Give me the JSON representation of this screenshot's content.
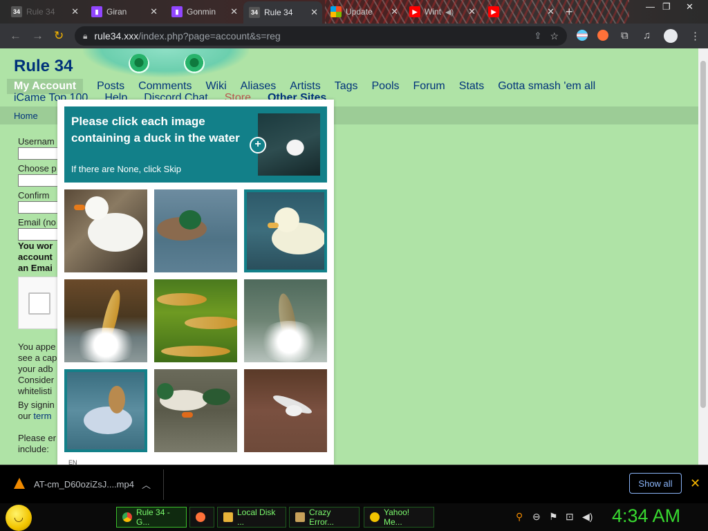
{
  "browser": {
    "tabs": [
      {
        "title": "Rule 34",
        "favicon": "34",
        "favicon_color": "#444444"
      },
      {
        "title": "Giran",
        "favicon": "T",
        "favicon_color": "#9146ff"
      },
      {
        "title": "Gonmin",
        "favicon": "T",
        "favicon_color": "#9146ff"
      },
      {
        "title": "Rule 34",
        "favicon": "34",
        "favicon_color": "#444444",
        "active": true
      },
      {
        "title": "Update",
        "favicon": "ms",
        "favicon_color": "#f25022"
      },
      {
        "title": "Wint",
        "favicon": "yt",
        "favicon_color": "#ff0000"
      },
      {
        "title": "",
        "favicon": "yt",
        "favicon_color": "#ff0000"
      }
    ],
    "new_tab": "+",
    "address": {
      "host": "rule34.xxx",
      "path": "/index.php?page=account&s=reg"
    }
  },
  "site": {
    "title": "Rule 34",
    "nav": [
      "My Account",
      "Posts",
      "Comments",
      "Wiki",
      "Aliases",
      "Artists",
      "Tags",
      "Pools",
      "Forum",
      "Stats",
      "Gotta smash 'em all"
    ],
    "nav2": [
      "iCame Top 100",
      "Help",
      "Discord Chat",
      "Store",
      "Other Sites"
    ],
    "subnav": {
      "home": "Home"
    }
  },
  "form": {
    "username": "Usernam",
    "password": "Choose p",
    "confirm": "Confirm",
    "email": "Email (no",
    "warning": [
      "You wor",
      "account",
      "an Emai"
    ],
    "adblock": [
      "You appe",
      "see a cap",
      "your adb",
      "Consider",
      "whitelisti"
    ],
    "signing": [
      "By signin"
    ],
    "terms_prefix": "our ",
    "terms_link": "term",
    "please": [
      "Please er",
      "include:"
    ]
  },
  "captcha": {
    "prompt": "Please click each image containing a duck in the water",
    "sub": "If there are None, click Skip",
    "language": "EN",
    "grid": [
      {
        "subject": "white-duck-on-rocks",
        "selected": false
      },
      {
        "subject": "mallard-in-water",
        "selected": false
      },
      {
        "subject": "white-duck-in-water",
        "selected": true
      },
      {
        "subject": "fish-jumping",
        "selected": false
      },
      {
        "subject": "fish-underwater",
        "selected": false
      },
      {
        "subject": "fish-splashing",
        "selected": false
      },
      {
        "subject": "pale-duck-in-water",
        "selected": true
      },
      {
        "subject": "mallards-swimming",
        "selected": false
      },
      {
        "subject": "bird-over-water",
        "selected": false
      }
    ],
    "accent": "#128089"
  },
  "downloads": {
    "file": "AT-cm_D60oziZsJ....mp4",
    "show_all": "Show all"
  },
  "taskbar": {
    "tasks": [
      {
        "label": "Rule 34 - G...",
        "icon": "chrome-icon",
        "color": "#4285f4"
      },
      {
        "label": "",
        "icon": "firefox-icon",
        "color": "#ff7139"
      },
      {
        "label": "Local Disk ...",
        "icon": "folder-icon",
        "color": "#e8b339"
      },
      {
        "label": "Crazy Error...",
        "icon": "document-icon",
        "color": "#c8a15a"
      },
      {
        "label": "Yahoo! Me...",
        "icon": "smiley-icon",
        "color": "#f2c400"
      }
    ],
    "clock": "4:34 AM"
  }
}
